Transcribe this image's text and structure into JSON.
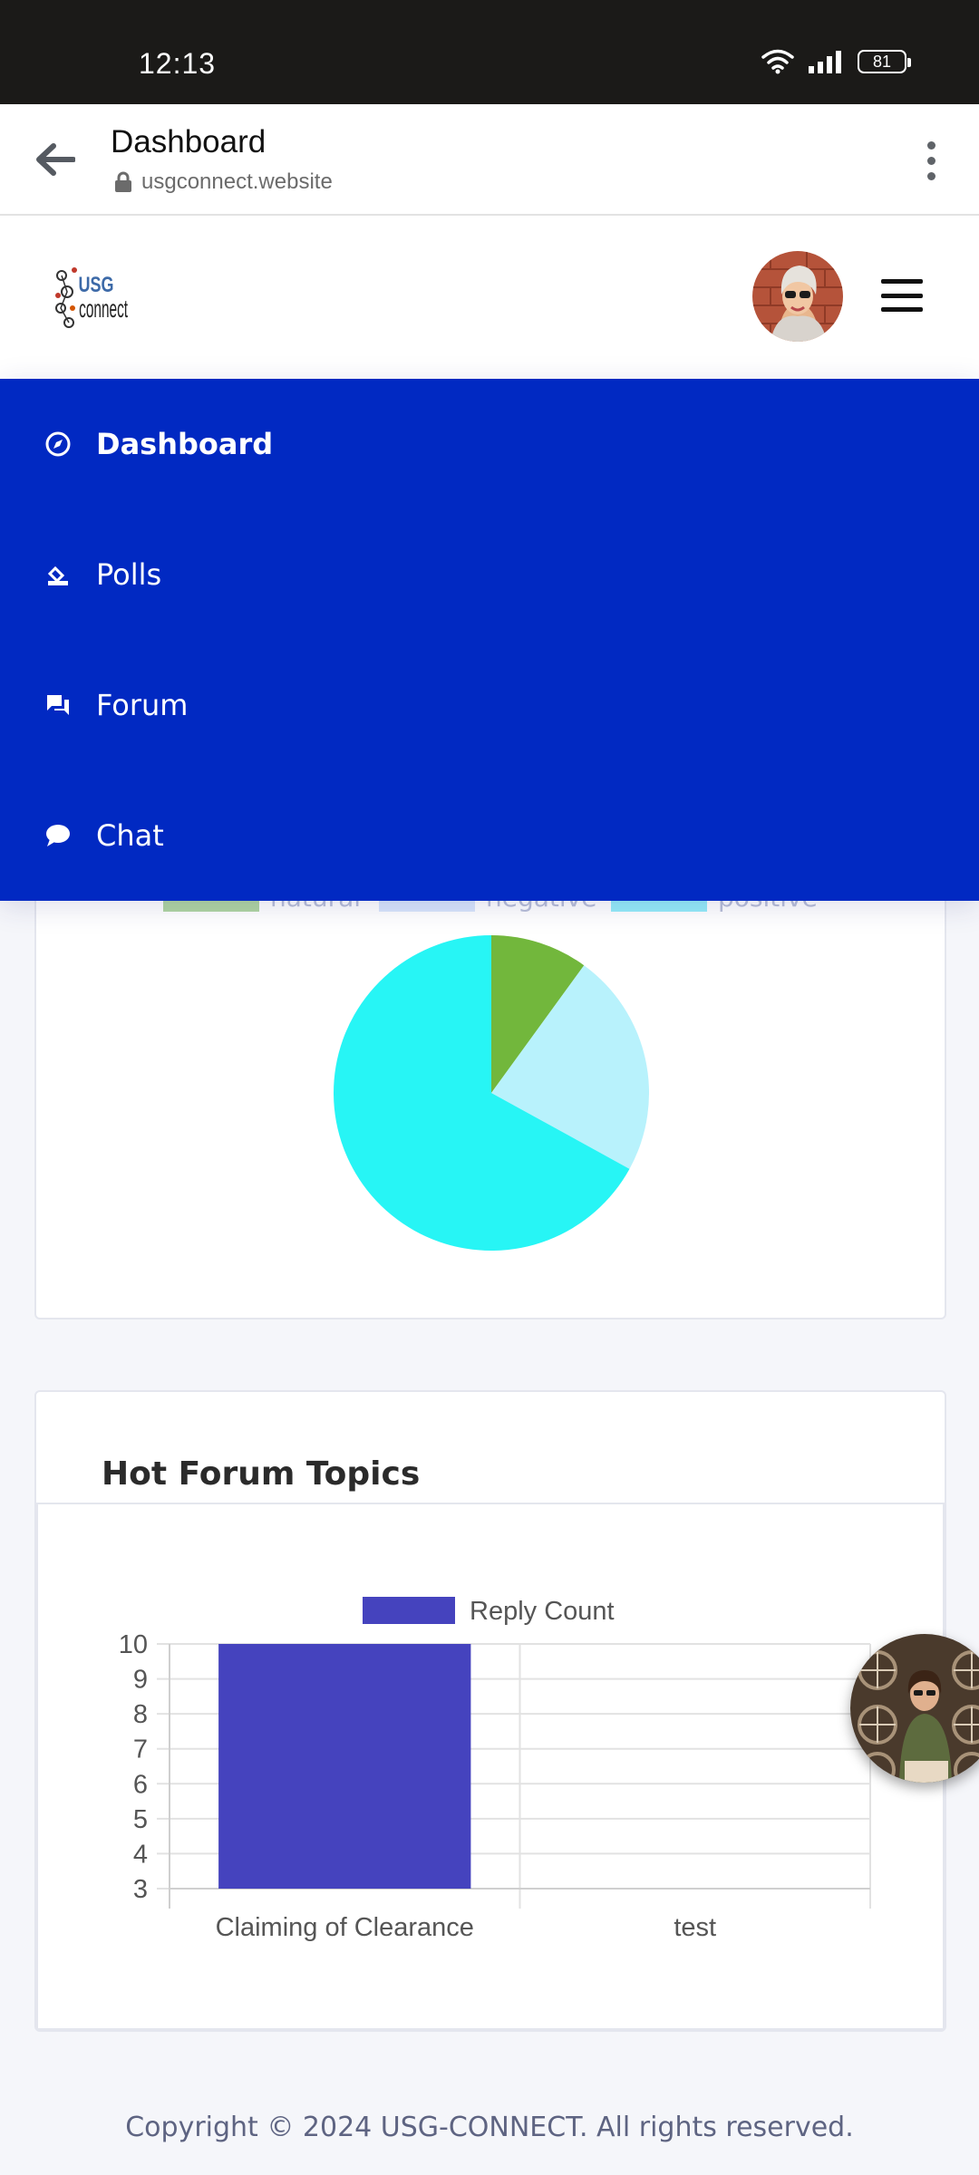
{
  "status_bar": {
    "time": "12:13",
    "battery": "81"
  },
  "browser": {
    "title": "Dashboard",
    "url": "usgconnect.website"
  },
  "logo": {
    "text": "USG connect"
  },
  "nav": {
    "items": [
      {
        "label": "Dashboard",
        "icon": "compass-icon",
        "active": true
      },
      {
        "label": "Polls",
        "icon": "ballot-icon",
        "active": false
      },
      {
        "label": "Forum",
        "icon": "chat-bubbles-icon",
        "active": false
      },
      {
        "label": "Chat",
        "icon": "chat-icon",
        "active": false
      }
    ]
  },
  "sentiment_chart": {
    "chart_data": {
      "type": "pie",
      "labels": [
        "natural",
        "negative",
        "positive"
      ],
      "values": [
        10,
        23,
        67
      ],
      "colors": [
        "#72b73c",
        "#b8f2fc",
        "#27f5f5"
      ]
    }
  },
  "forum": {
    "title": "Hot Forum Topics",
    "chart_data": {
      "type": "bar",
      "categories": [
        "Claiming of Clearance",
        "test"
      ],
      "series": [
        {
          "name": "Reply Count",
          "values": [
            10,
            3
          ],
          "color": "#4543be"
        }
      ],
      "ylim": [
        3,
        10
      ],
      "yticks": [
        3,
        4,
        5,
        6,
        7,
        8,
        9,
        10
      ],
      "grid": true,
      "legend": "top-center"
    }
  },
  "footer": {
    "text": "Copyright © 2024 USG-CONNECT. All rights reserved."
  }
}
